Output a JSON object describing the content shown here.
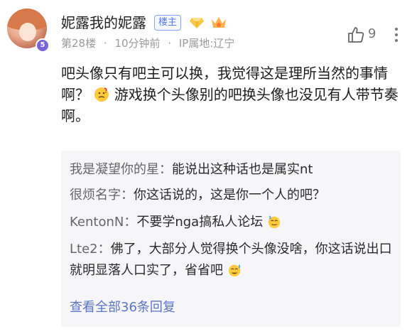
{
  "user": {
    "name": "妮露我的妮露",
    "level": "5",
    "host_tag": "楼主"
  },
  "meta": {
    "floor": "第28楼",
    "dot1": "·",
    "time": "10分钟前",
    "dot2": "·",
    "ip": "IP属地:辽宁"
  },
  "like_count": "9",
  "post": {
    "text_part1": "吧头像只有吧主可以换，我觉得这是理所当然的事情啊？",
    "text_part2": "游戏换个头像别的吧换头像也没见有人带节奏啊。"
  },
  "replies": [
    {
      "name": "我是凝望你的星：",
      "text": "能说出这种话也是属实nt"
    },
    {
      "name": "很烦名字：",
      "text": "你这话说的，这是你一个人的吧？"
    },
    {
      "name": "KentonN：",
      "text": "不要学nga搞私人论坛"
    },
    {
      "name": "Lte2：",
      "text": "佛了，大部分人觉得换个头像没啥，你这话说出口就明显落人口实了，省省吧"
    }
  ],
  "view_all": "查看全部36条回复",
  "colors": {
    "accent_blue": "#5b74c8",
    "tag_blue": "#5577f0",
    "meta_gray": "#9a9a9a",
    "reply_bg": "#f6f6f8"
  },
  "icons": [
    "diamond-icon",
    "crown-icon",
    "thumbs-up-icon",
    "more-icon",
    "thinking-emoji",
    "sweat-emoji"
  ]
}
